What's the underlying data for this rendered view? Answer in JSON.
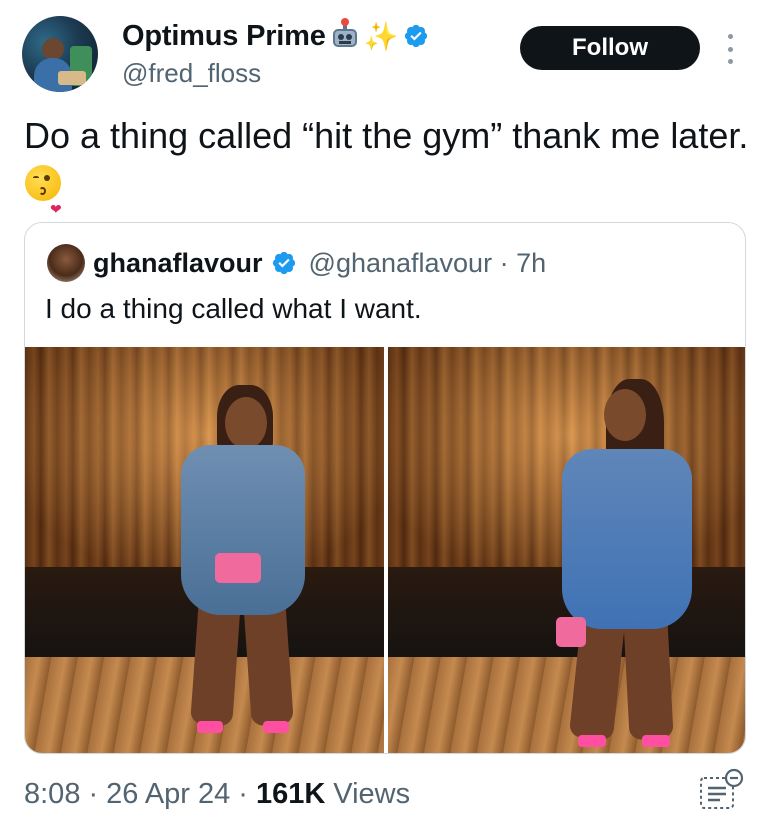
{
  "author": {
    "name": "Optimus Prime",
    "name_emojis": [
      "robot-icon",
      "sparkles-icon"
    ],
    "verified": true,
    "handle": "@fred_floss"
  },
  "actions": {
    "follow_label": "Follow",
    "more_icon": "more-vertical-icon"
  },
  "tweet": {
    "text": "Do a thing called “hit the gym” thank me later.",
    "trailing_emoji": "face-blowing-kiss-icon"
  },
  "quoted": {
    "name": "ghanaflavour",
    "verified": true,
    "handle": "@ghanaflavour",
    "separator": "·",
    "age": "7h",
    "text": "I do a thing called what I want.",
    "media_count": 2
  },
  "meta": {
    "time": "8:08",
    "sep1": "·",
    "date": "26 Apr 24",
    "sep2": "·",
    "views_count": "161K",
    "views_label": "Views",
    "analytics_icon": "analytics-icon"
  },
  "colors": {
    "text": "#0f1419",
    "muted": "#536471",
    "verified_blue": "#1d9bf0",
    "follow_bg": "#0f1419",
    "border": "#cfd9de"
  }
}
